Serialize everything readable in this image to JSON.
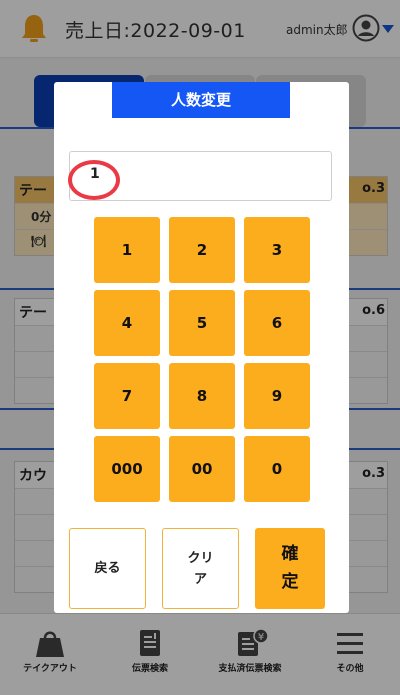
{
  "header": {
    "title": "売上日:2022-09-01",
    "user_name": "admin太郎"
  },
  "cards": [
    {
      "left_label": "テー",
      "right_label": "o.3",
      "sub_value": "0分"
    },
    {
      "left_label": "テー",
      "right_label": "o.6"
    },
    {
      "left_label": "カウ",
      "right_label": "o.3"
    }
  ],
  "bottom_nav": {
    "items": [
      {
        "label": "テイクアウト",
        "icon": "takeout-bag-icon"
      },
      {
        "label": "伝票検索",
        "icon": "receipt-search-icon"
      },
      {
        "label": "支払済伝票検索",
        "icon": "paid-receipt-search-icon"
      },
      {
        "label": "その他",
        "icon": "menu-icon"
      }
    ]
  },
  "modal": {
    "title": "人数変更",
    "input_value": "1",
    "keypad": [
      "1",
      "2",
      "3",
      "4",
      "5",
      "6",
      "7",
      "8",
      "9",
      "000",
      "00",
      "0"
    ],
    "back_label": "戻る",
    "clear_label_line1": "クリ",
    "clear_label_line2": "ア",
    "confirm_label_line1": "確",
    "confirm_label_line2": "定"
  },
  "colors": {
    "accent_orange": "#fcad1d",
    "brand_blue": "#1557f5",
    "highlight_red": "#ea3a45"
  }
}
